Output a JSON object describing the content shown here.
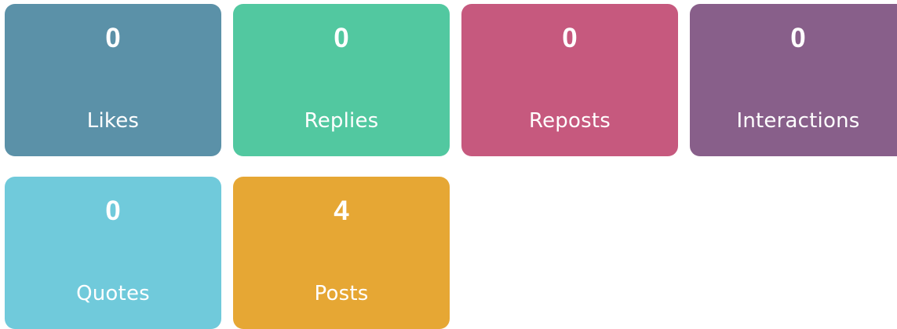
{
  "stats": [
    {
      "value": "0",
      "label": "Likes",
      "color": "#5b91a8"
    },
    {
      "value": "0",
      "label": "Replies",
      "color": "#52c8a0"
    },
    {
      "value": "0",
      "label": "Reposts",
      "color": "#c6597e"
    },
    {
      "value": "0",
      "label": "Interactions",
      "color": "#885f8a"
    },
    {
      "value": "0",
      "label": "Quotes",
      "color": "#70cadb"
    },
    {
      "value": "4",
      "label": "Posts",
      "color": "#e6a734"
    }
  ]
}
